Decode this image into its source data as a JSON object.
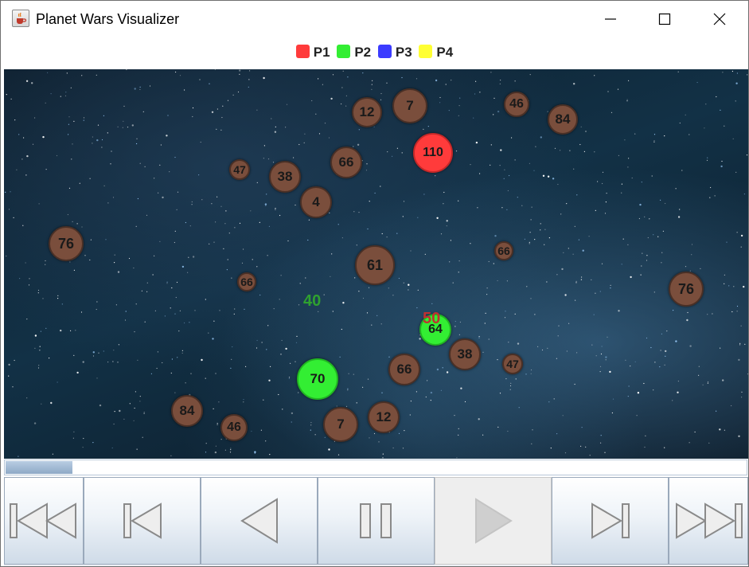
{
  "window": {
    "title": "Planet Wars Visualizer",
    "icon": "java-cup-icon",
    "controls": [
      "minimize-icon",
      "maximize-icon",
      "close-icon"
    ]
  },
  "legend": {
    "items": [
      {
        "label": "P1",
        "color": "#ff3b3b"
      },
      {
        "label": "P2",
        "color": "#33ee33"
      },
      {
        "label": "P3",
        "color": "#3b3bff"
      },
      {
        "label": "P4",
        "color": "#ffff33"
      }
    ]
  },
  "board": {
    "planets": [
      {
        "ships": "12",
        "owner": "neutral"
      },
      {
        "ships": "7",
        "owner": "neutral"
      },
      {
        "ships": "46",
        "owner": "neutral"
      },
      {
        "ships": "84",
        "owner": "neutral"
      },
      {
        "ships": "110",
        "owner": "P1"
      },
      {
        "ships": "47",
        "owner": "neutral"
      },
      {
        "ships": "38",
        "owner": "neutral"
      },
      {
        "ships": "66",
        "owner": "neutral"
      },
      {
        "ships": "4",
        "owner": "neutral"
      },
      {
        "ships": "76",
        "owner": "neutral"
      },
      {
        "ships": "61",
        "owner": "neutral"
      },
      {
        "ships": "66",
        "owner": "neutral"
      },
      {
        "ships": "66",
        "owner": "neutral"
      },
      {
        "ships": "76",
        "owner": "neutral"
      },
      {
        "ships": "64",
        "owner": "P2"
      },
      {
        "ships": "38",
        "owner": "neutral"
      },
      {
        "ships": "47",
        "owner": "neutral"
      },
      {
        "ships": "70",
        "owner": "P2"
      },
      {
        "ships": "66",
        "owner": "neutral"
      },
      {
        "ships": "84",
        "owner": "neutral"
      },
      {
        "ships": "46",
        "owner": "neutral"
      },
      {
        "ships": "7",
        "owner": "neutral"
      },
      {
        "ships": "12",
        "owner": "neutral"
      }
    ],
    "fleets": [
      {
        "ships": "40",
        "owner": "P2",
        "color": "#2fa12f"
      },
      {
        "ships": "50",
        "owner": "P1",
        "color": "#c03030"
      }
    ]
  },
  "progress": {
    "fraction": 0.09
  },
  "playback": {
    "buttons": [
      {
        "name": "first-turn-button",
        "icon": "skip-to-start-icon",
        "enabled": true
      },
      {
        "name": "step-back-button",
        "icon": "step-back-icon",
        "enabled": true
      },
      {
        "name": "play-backward-button",
        "icon": "play-backward-icon",
        "enabled": true
      },
      {
        "name": "pause-button",
        "icon": "pause-icon",
        "enabled": true
      },
      {
        "name": "play-button",
        "icon": "play-icon",
        "enabled": false
      },
      {
        "name": "step-forward-button",
        "icon": "step-forward-icon",
        "enabled": true
      },
      {
        "name": "last-turn-button",
        "icon": "skip-to-end-icon",
        "enabled": true
      }
    ]
  }
}
